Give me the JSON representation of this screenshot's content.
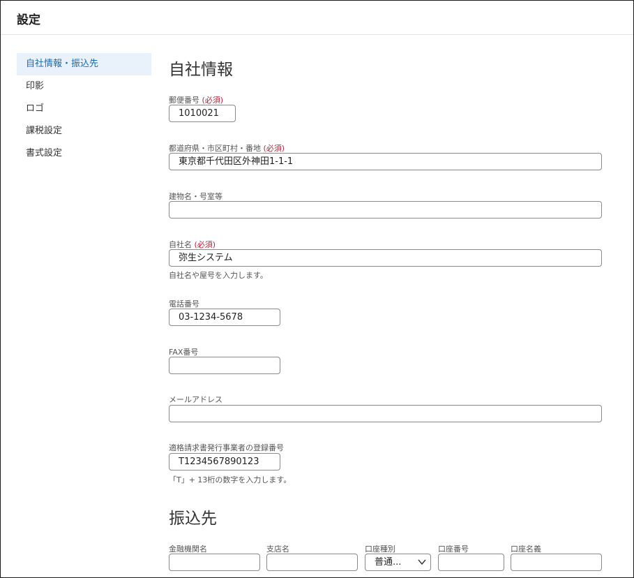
{
  "header": {
    "title": "設定"
  },
  "sidebar": {
    "items": [
      {
        "label": "自社情報・振込先",
        "active": true
      },
      {
        "label": "印影"
      },
      {
        "label": "ロゴ"
      },
      {
        "label": "課税設定"
      },
      {
        "label": "書式設定"
      }
    ]
  },
  "company": {
    "section_title": "自社情報",
    "required_mark": "(必須)",
    "postal": {
      "label": "郵便番号",
      "value": "1010021"
    },
    "address": {
      "label": "都道府県・市区町村・番地",
      "value": "東京都千代田区外神田1-1-1"
    },
    "building": {
      "label": "建物名・号室等",
      "value": ""
    },
    "name": {
      "label": "自社名",
      "value": "弥生システム",
      "help": "自社名や屋号を入力します。"
    },
    "phone": {
      "label": "電話番号",
      "value": "03-1234-5678"
    },
    "fax": {
      "label": "FAX番号",
      "value": ""
    },
    "email": {
      "label": "メールアドレス",
      "value": ""
    },
    "registration": {
      "label": "適格請求書発行事業者の登録番号",
      "value": "T1234567890123",
      "help": "「T」+ 13桁の数字を入力します。"
    }
  },
  "bank": {
    "section_title": "振込先",
    "bank_name": {
      "label": "金融機関名",
      "value": ""
    },
    "branch": {
      "label": "支店名",
      "value": ""
    },
    "account_type": {
      "label": "口座種別",
      "value": "普通..."
    },
    "account_number": {
      "label": "口座番号",
      "value": ""
    },
    "account_holder": {
      "label": "口座名義",
      "value": ""
    }
  }
}
